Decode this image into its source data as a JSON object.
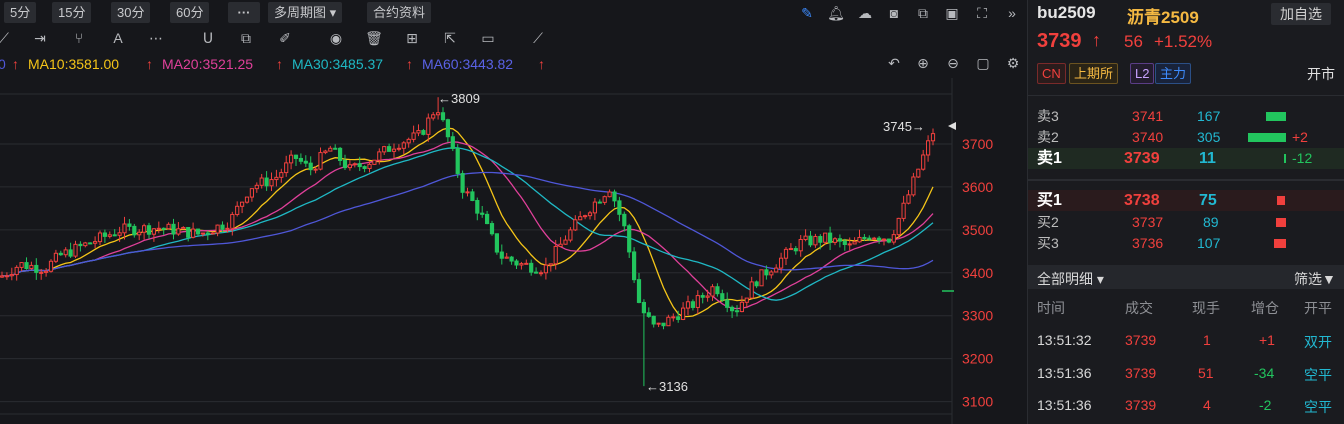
{
  "toolbar": {
    "periods": [
      "5分",
      "15分",
      "30分",
      "60分"
    ],
    "more_icon": "more-dots",
    "multi_period": "多周期图",
    "contract_info": "合约资料",
    "right_icons": [
      "pencil-icon",
      "bell-icon",
      "cloud-icon",
      "camera-icon",
      "copy-icon",
      "monitor-icon",
      "fullscreen-icon",
      "collapse-icon"
    ]
  },
  "drawing_tools": [
    "line-tool-icon",
    "range-tool-icon",
    "fork-tool-icon",
    "text-tool-icon",
    "dots-tool-icon",
    "magnet-icon",
    "layers-icon",
    "brush-icon",
    "eye-icon",
    "trash-icon",
    "grid-icon",
    "export-icon",
    "comment-icon",
    "ruler-icon"
  ],
  "ma": {
    "ma10": "MA10:3581.00",
    "ma20": "MA20:3521.25",
    "ma30": "MA30:3485.37",
    "ma60": "MA60:3443.82",
    "colors": {
      "ma10": "#f5c518",
      "ma20": "#e0409a",
      "ma30": "#1fb8c4",
      "ma60": "#4f57d8"
    }
  },
  "chart_data": {
    "type": "candlestick",
    "y_ticks": [
      3700,
      3600,
      3500,
      3400,
      3300,
      3200,
      3100
    ],
    "ylim": [
      3070,
      3800
    ],
    "annotations": {
      "high": "←3809",
      "low": "←3136",
      "last": "3745→"
    },
    "high": 3809,
    "low": 3136,
    "last": 3745
  },
  "quote": {
    "symbol": "bu2509",
    "name": "沥青2509",
    "add_watch": "加自选",
    "price": "3739",
    "change": "56",
    "change_pct": "+1.52%",
    "tags": [
      "CN",
      "上期所",
      "L2",
      "主力"
    ],
    "open_status": "开市"
  },
  "book": {
    "asks": [
      {
        "label": "卖3",
        "price": "3741",
        "vol": "167",
        "delta": ""
      },
      {
        "label": "卖2",
        "price": "3740",
        "vol": "305",
        "delta": "+2"
      },
      {
        "label": "卖1",
        "price": "3739",
        "vol": "11",
        "delta": "-12"
      }
    ],
    "bids": [
      {
        "label": "买1",
        "price": "3738",
        "vol": "75"
      },
      {
        "label": "买2",
        "price": "3737",
        "vol": "89"
      },
      {
        "label": "买3",
        "price": "3736",
        "vol": "107"
      }
    ]
  },
  "ticks": {
    "filter_label": "全部明细",
    "screen_label": "筛选",
    "headers": [
      "时间",
      "成交",
      "现手",
      "增仓",
      "开平"
    ],
    "rows": [
      {
        "time": "13:51:32",
        "price": "3739",
        "qty": "1",
        "oi": "+1",
        "type": "双开"
      },
      {
        "time": "13:51:36",
        "price": "3739",
        "qty": "51",
        "oi": "-34",
        "type": "空平"
      },
      {
        "time": "13:51:36",
        "price": "3739",
        "qty": "4",
        "oi": "-2",
        "type": "空平"
      }
    ]
  }
}
